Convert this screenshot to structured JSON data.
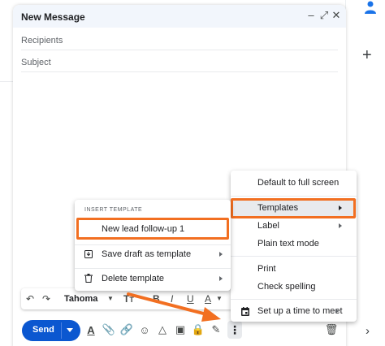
{
  "compose": {
    "title": "New Message",
    "recipients_placeholder": "Recipients",
    "subject_placeholder": "Subject"
  },
  "toolbar": {
    "send_label": "Send",
    "font_name": "Tahoma"
  },
  "main_menu": {
    "items": [
      {
        "label": "Default to full screen"
      },
      {
        "label": "Templates"
      },
      {
        "label": "Label"
      },
      {
        "label": "Plain text mode"
      },
      {
        "label": "Print"
      },
      {
        "label": "Check spelling"
      },
      {
        "label": "Set up a time to meet"
      }
    ]
  },
  "template_menu": {
    "heading": "INSERT TEMPLATE",
    "items": [
      {
        "label": "New lead follow-up 1"
      },
      {
        "label": "Save draft as template"
      },
      {
        "label": "Delete template"
      }
    ]
  },
  "colors": {
    "highlight": "#f26f21",
    "send_button": "#0b57d0",
    "header_bg": "#f2f6fc"
  },
  "icons": [
    "person-icon",
    "plus-icon",
    "minimize-icon",
    "expand-icon",
    "close-icon",
    "undo-icon",
    "redo-icon",
    "text-size-icon",
    "bold-icon",
    "text-color-icon",
    "formatting-icon",
    "attach-icon",
    "link-icon",
    "emoji-icon",
    "drive-icon",
    "photo-icon",
    "confidential-icon",
    "signature-icon",
    "more-options-icon",
    "trash-icon",
    "save-icon",
    "calendar-icon",
    "chevron-right-icon"
  ]
}
